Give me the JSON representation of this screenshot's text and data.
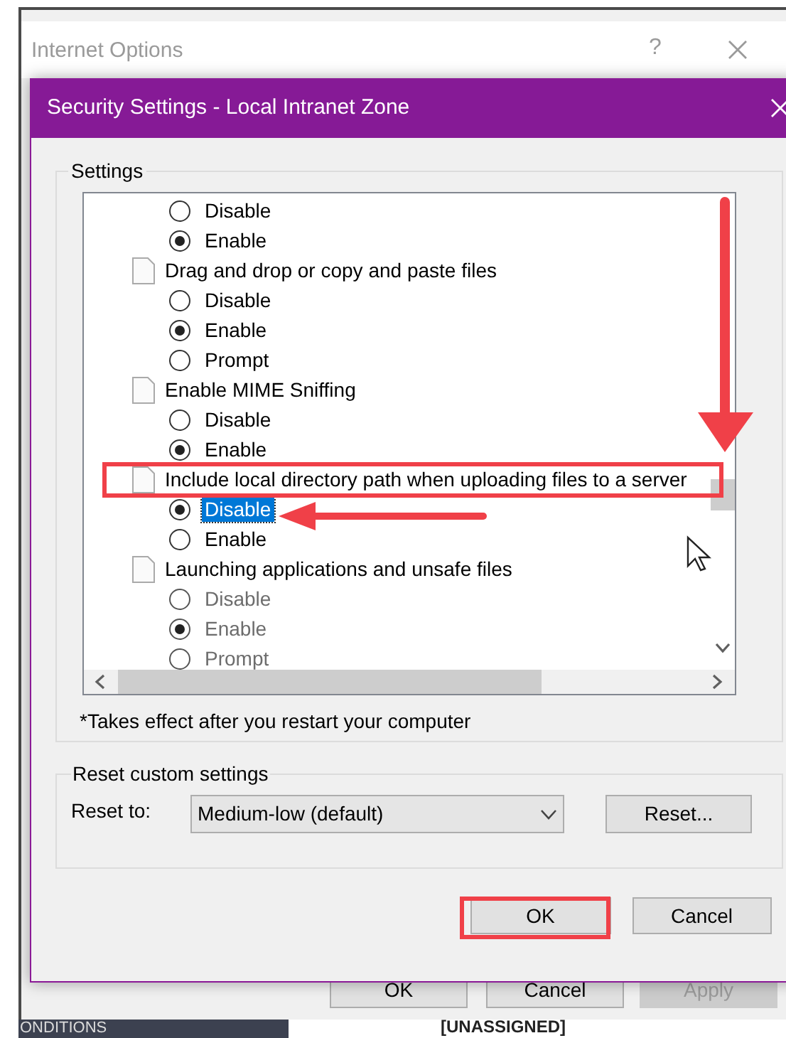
{
  "back_window": {
    "title": "Internet Options",
    "help": "?",
    "buttons": [
      {
        "label": "OK",
        "disabled": false
      },
      {
        "label": "Cancel",
        "disabled": false
      },
      {
        "label": "Apply",
        "disabled": true
      }
    ]
  },
  "background": {
    "tab": "ONDITIONS",
    "field": "[UNASSIGNED]"
  },
  "dialog": {
    "title": "Security Settings - Local Intranet Zone",
    "settings_group": "Settings",
    "settings": [
      {
        "children": [
          {
            "label": "Disable",
            "selected": false,
            "focused": false,
            "disabled": false
          },
          {
            "label": "Enable",
            "selected": true,
            "focused": false,
            "disabled": false
          }
        ]
      },
      {
        "label": "Drag and drop or copy and paste files",
        "outlined": false,
        "children": [
          {
            "label": "Disable",
            "selected": false,
            "focused": false,
            "disabled": false
          },
          {
            "label": "Enable",
            "selected": true,
            "focused": false,
            "disabled": false
          },
          {
            "label": "Prompt",
            "selected": false,
            "focused": false,
            "disabled": false
          }
        ]
      },
      {
        "label": "Enable MIME Sniffing",
        "outlined": false,
        "children": [
          {
            "label": "Disable",
            "selected": false,
            "focused": false,
            "disabled": false
          },
          {
            "label": "Enable",
            "selected": true,
            "focused": false,
            "disabled": false
          }
        ]
      },
      {
        "label": "Include local directory path when uploading files to a server",
        "outlined": true,
        "children": [
          {
            "label": "Disable",
            "selected": true,
            "focused": true,
            "disabled": false
          },
          {
            "label": "Enable",
            "selected": false,
            "focused": false,
            "disabled": false
          }
        ]
      },
      {
        "label": "Launching applications and unsafe files",
        "outlined": false,
        "children": [
          {
            "label": "Disable",
            "selected": false,
            "focused": false,
            "disabled": true
          },
          {
            "label": "Enable",
            "selected": true,
            "focused": false,
            "disabled": true
          },
          {
            "label": "Prompt",
            "selected": false,
            "focused": false,
            "disabled": true
          }
        ]
      }
    ],
    "note": "*Takes effect after you restart your computer",
    "reset_group": "Reset custom settings",
    "reset_label": "Reset to:",
    "reset_value": "Medium-low (default)",
    "reset_button": "Reset...",
    "buttons": [
      "OK",
      "Cancel"
    ]
  }
}
